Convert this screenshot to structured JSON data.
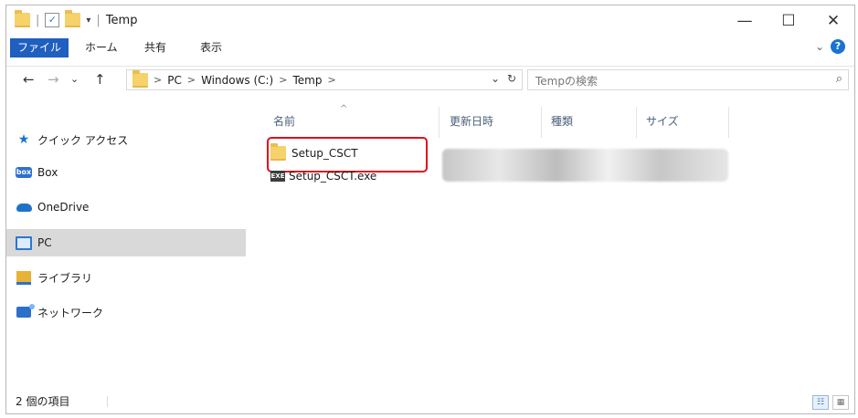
{
  "window": {
    "title": "Temp",
    "quick_access_separator": "|",
    "quick_access_dropdown": "▾",
    "minimize_glyph": "—",
    "maximize_glyph": "☐",
    "close_glyph": "✕"
  },
  "ribbon": {
    "tabs": [
      "ファイル",
      "ホーム",
      "共有",
      "表示"
    ],
    "collapse_glyph": "⌄",
    "help_glyph": "?"
  },
  "navigation": {
    "back_glyph": "←",
    "forward_glyph": "→",
    "recent_glyph": "⌄",
    "up_glyph": "↑"
  },
  "address": {
    "segments": [
      "PC",
      "Windows (C:)",
      "Temp"
    ],
    "separator": ">",
    "dropdown_glyph": "⌄",
    "refresh_glyph": "↻"
  },
  "search": {
    "placeholder": "Tempの検索",
    "icon_glyph": "⌕"
  },
  "sidebar": {
    "items": [
      {
        "label": "クイック アクセス",
        "icon": "star-icon"
      },
      {
        "label": "Box",
        "icon": "box-icon",
        "icon_text": "box"
      },
      {
        "label": "OneDrive",
        "icon": "cloud-icon"
      },
      {
        "label": "PC",
        "icon": "pc-icon",
        "selected": true
      },
      {
        "label": "ライブラリ",
        "icon": "library-icon"
      },
      {
        "label": "ネットワーク",
        "icon": "network-icon"
      }
    ]
  },
  "file_list": {
    "columns": [
      "名前",
      "更新日時",
      "種類",
      "サイズ"
    ],
    "sort_indicator": "^",
    "files": [
      {
        "name": "Setup_CSCT",
        "icon": "folder-icon",
        "highlighted": true
      },
      {
        "name": "Setup_CSCT.exe",
        "icon": "exe-icon",
        "icon_text": "EXE"
      }
    ]
  },
  "status_bar": {
    "item_count": "2 個の項目"
  },
  "colors": {
    "file_tab_bg": "#1f5fbf",
    "highlight_border": "#e00f1b",
    "selected_sidebar_bg": "#d9d9d9",
    "folder_yellow": "#f6d26b"
  }
}
